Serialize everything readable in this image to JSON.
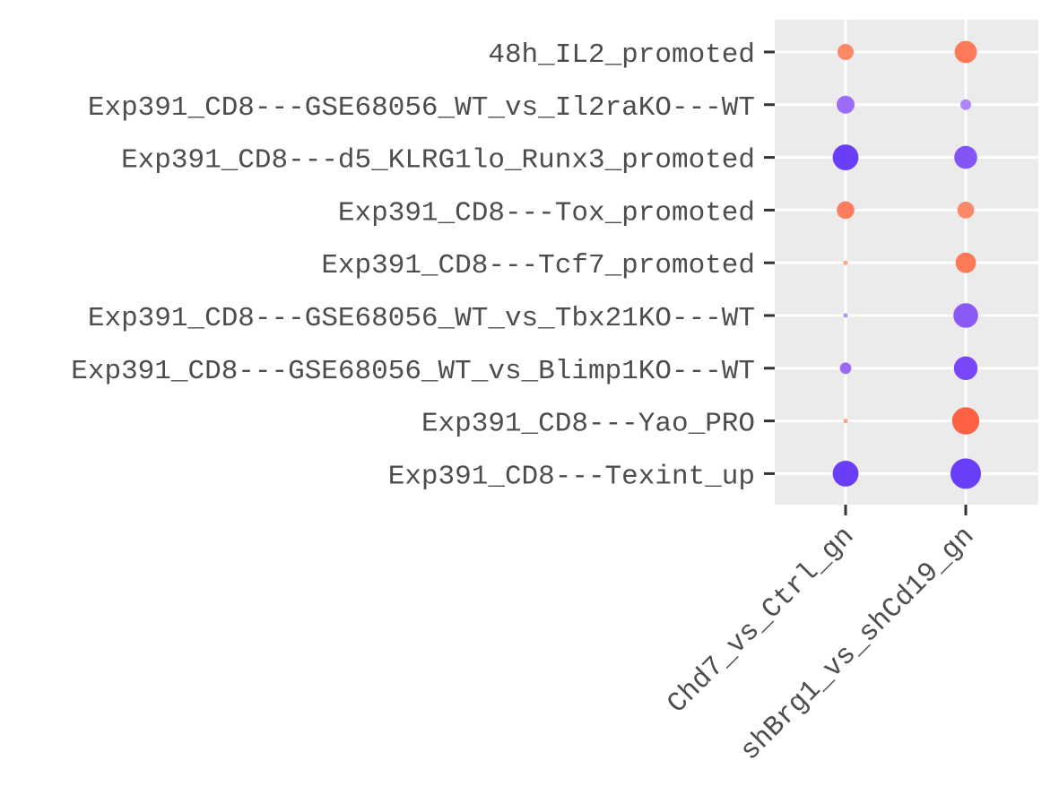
{
  "chart_data": {
    "type": "scatter",
    "subtype": "dot-plot",
    "title": "",
    "xlabel": "",
    "ylabel": "",
    "x_categories": [
      "Chd7_vs_Ctrl_gn",
      "shBrg1_vs_shCd19_gn"
    ],
    "y_categories": [
      "48h_IL2_promoted",
      "Exp391_CD8---GSE68056_WT_vs_Il2raKO---WT",
      "Exp391_CD8---d5_KLRG1lo_Runx3_promoted",
      "Exp391_CD8---Tox_promoted",
      "Exp391_CD8---Tcf7_promoted",
      "Exp391_CD8---GSE68056_WT_vs_Tbx21KO---WT",
      "Exp391_CD8---GSE68056_WT_vs_Blimp1KO---WT",
      "Exp391_CD8---Yao_PRO",
      "Exp391_CD8---Texint_up"
    ],
    "points": [
      {
        "x": "Chd7_vs_Ctrl_gn",
        "y": "48h_IL2_promoted",
        "size": 0.45,
        "color": "#fc8a6a"
      },
      {
        "x": "shBrg1_vs_shCd19_gn",
        "y": "48h_IL2_promoted",
        "size": 0.62,
        "color": "#fd7a58"
      },
      {
        "x": "Chd7_vs_Ctrl_gn",
        "y": "Exp391_CD8---GSE68056_WT_vs_Il2raKO---WT",
        "size": 0.5,
        "color": "#9b6cf8"
      },
      {
        "x": "shBrg1_vs_shCd19_gn",
        "y": "Exp391_CD8---GSE68056_WT_vs_Il2raKO---WT",
        "size": 0.3,
        "color": "#ae85f6"
      },
      {
        "x": "Chd7_vs_Ctrl_gn",
        "y": "Exp391_CD8---d5_KLRG1lo_Runx3_promoted",
        "size": 0.72,
        "color": "#6a3ef9"
      },
      {
        "x": "shBrg1_vs_shCd19_gn",
        "y": "Exp391_CD8---d5_KLRG1lo_Runx3_promoted",
        "size": 0.64,
        "color": "#8454f7"
      },
      {
        "x": "Chd7_vs_Ctrl_gn",
        "y": "Exp391_CD8---Tox_promoted",
        "size": 0.49,
        "color": "#fd7d5e"
      },
      {
        "x": "shBrg1_vs_shCd19_gn",
        "y": "Exp391_CD8---Tox_promoted",
        "size": 0.47,
        "color": "#fc8a6a"
      },
      {
        "x": "Chd7_vs_Ctrl_gn",
        "y": "Exp391_CD8---Tcf7_promoted",
        "size": 0.13,
        "color": "#fca38a"
      },
      {
        "x": "shBrg1_vs_shCd19_gn",
        "y": "Exp391_CD8---Tcf7_promoted",
        "size": 0.57,
        "color": "#fd7a58"
      },
      {
        "x": "Chd7_vs_Ctrl_gn",
        "y": "Exp391_CD8---GSE68056_WT_vs_Tbx21KO---WT",
        "size": 0.12,
        "color": "#b197f7"
      },
      {
        "x": "shBrg1_vs_shCd19_gn",
        "y": "Exp391_CD8---GSE68056_WT_vs_Tbx21KO---WT",
        "size": 0.69,
        "color": "#8a5af7"
      },
      {
        "x": "Chd7_vs_Ctrl_gn",
        "y": "Exp391_CD8---GSE68056_WT_vs_Blimp1KO---WT",
        "size": 0.32,
        "color": "#9a6af7"
      },
      {
        "x": "shBrg1_vs_shCd19_gn",
        "y": "Exp391_CD8---GSE68056_WT_vs_Blimp1KO---WT",
        "size": 0.66,
        "color": "#7848f8"
      },
      {
        "x": "Chd7_vs_Ctrl_gn",
        "y": "Exp391_CD8---Yao_PRO",
        "size": 0.13,
        "color": "#fca38a"
      },
      {
        "x": "shBrg1_vs_shCd19_gn",
        "y": "Exp391_CD8---Yao_PRO",
        "size": 0.76,
        "color": "#fd6143"
      },
      {
        "x": "Chd7_vs_Ctrl_gn",
        "y": "Exp391_CD8---Texint_up",
        "size": 0.72,
        "color": "#6a3ef9"
      },
      {
        "x": "shBrg1_vs_shCd19_gn",
        "y": "Exp391_CD8---Texint_up",
        "size": 0.85,
        "color": "#6a3ef9"
      }
    ],
    "grid": true,
    "legend": "none"
  },
  "theme": {
    "panel_bg": "#ebebeb",
    "grid_color": "#ffffff",
    "tick_color": "#333333",
    "label_color": "#4d4d4d"
  }
}
